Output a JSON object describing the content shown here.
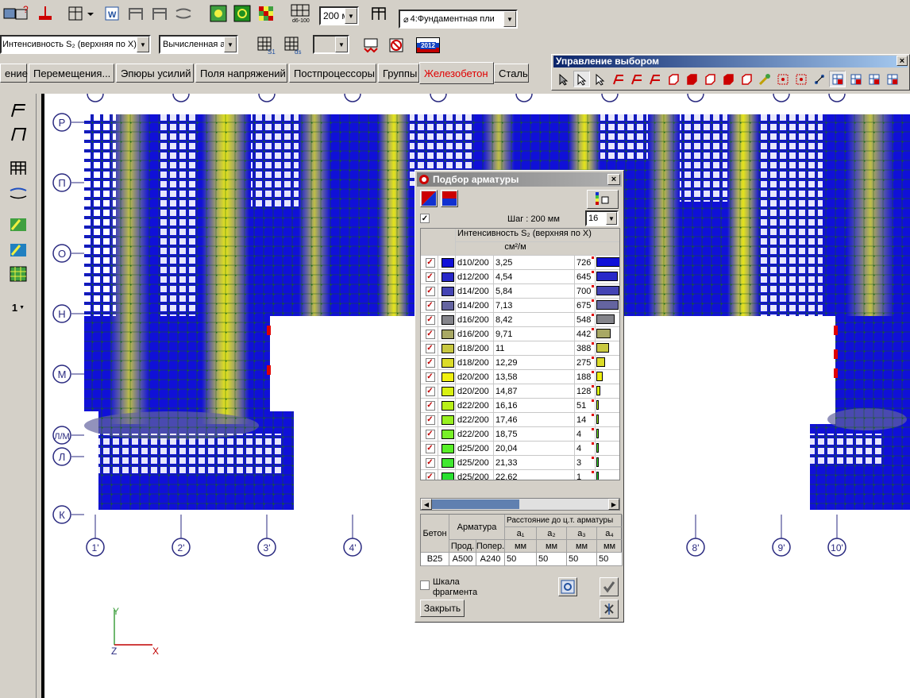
{
  "toolbar": {
    "step_combo": "200 м",
    "load_case_combo": "4:Фундаментная пли",
    "intensity_combo": "Интенсивность S₂ (верхняя по X)",
    "calc_combo": "Вычисленная а",
    "btn_2012": "2012"
  },
  "tabs": [
    {
      "label": "ение",
      "active": false
    },
    {
      "label": "Перемещения...",
      "active": false
    },
    {
      "label": "Эпюры усилий",
      "active": false
    },
    {
      "label": "Поля напряжений",
      "active": false
    },
    {
      "label": "Постпроцессоры",
      "active": false
    },
    {
      "label": "Группы",
      "active": false
    },
    {
      "label": "Железобетон",
      "active": true
    },
    {
      "label": "Сталь",
      "active": false
    }
  ],
  "left_tools": {
    "counter": "1"
  },
  "selection_panel": {
    "title": "Управление выбором"
  },
  "axes_rows": [
    "Р",
    "П",
    "О",
    "Н",
    "М",
    "Л/М",
    "Л",
    "К"
  ],
  "axes_cols": [
    "1'",
    "2'",
    "3'",
    "4'",
    "8'",
    "9'",
    "10'"
  ],
  "coord": {
    "y": "Y",
    "z": "Z",
    "x": "X"
  },
  "dialog": {
    "title": "Подбор арматуры",
    "step_label": "Шаг : 200 мм",
    "step_count": "16",
    "header_param": "Интенсивность S₂ (верхняя по X)",
    "header_unit": "см²/м",
    "rows": [
      {
        "name": "d10/200",
        "value": "3,25",
        "count": "726",
        "color": "#1010d8",
        "frac": 1.0
      },
      {
        "name": "d12/200",
        "value": "4,54",
        "count": "645",
        "color": "#2828c8",
        "frac": 0.89
      },
      {
        "name": "d14/200",
        "value": "5,84",
        "count": "700",
        "color": "#4444b4",
        "frac": 0.96
      },
      {
        "name": "d14/200",
        "value": "7,13",
        "count": "675",
        "color": "#6464a0",
        "frac": 0.93
      },
      {
        "name": "d16/200",
        "value": "8,42",
        "count": "548",
        "color": "#84848a",
        "frac": 0.75
      },
      {
        "name": "d16/200",
        "value": "9,71",
        "count": "442",
        "color": "#a8a864",
        "frac": 0.61
      },
      {
        "name": "d18/200",
        "value": "11",
        "count": "388",
        "color": "#c8c840",
        "frac": 0.53
      },
      {
        "name": "d18/200",
        "value": "12,29",
        "count": "275",
        "color": "#dcdc28",
        "frac": 0.38
      },
      {
        "name": "d20/200",
        "value": "13,58",
        "count": "188",
        "color": "#f0f010",
        "frac": 0.26
      },
      {
        "name": "d20/200",
        "value": "14,87",
        "count": "128",
        "color": "#d8f010",
        "frac": 0.18
      },
      {
        "name": "d22/200",
        "value": "16,16",
        "count": "51",
        "color": "#b8f018",
        "frac": 0.07
      },
      {
        "name": "d22/200",
        "value": "17,46",
        "count": "14",
        "color": "#98f020",
        "frac": 0.02
      },
      {
        "name": "d22/200",
        "value": "18,75",
        "count": "4",
        "color": "#78f028",
        "frac": 0.01
      },
      {
        "name": "d25/200",
        "value": "20,04",
        "count": "4",
        "color": "#58f028",
        "frac": 0.01
      },
      {
        "name": "d25/200",
        "value": "21,33",
        "count": "3",
        "color": "#40e830",
        "frac": 0.01
      },
      {
        "name": "d25/200",
        "value": "22,62",
        "count": "1",
        "color": "#28e030",
        "frac": 0.005
      }
    ],
    "params": {
      "concrete_label": "Бетон",
      "rebar_label": "Арматура",
      "dist_label": "Расстояние до ц.т. арматуры",
      "long_label": "Прод.",
      "trans_label": "Попер.",
      "a1": "a₁",
      "a2": "a₂",
      "a3": "a₃",
      "a4": "a₄",
      "unit": "мм",
      "concrete": "В25",
      "long": "А500",
      "trans": "А240",
      "v1": "50",
      "v2": "50",
      "v3": "50",
      "v4": "50"
    },
    "fragment_scale": "Шкала фрагмента",
    "close_button": "Закрыть"
  }
}
